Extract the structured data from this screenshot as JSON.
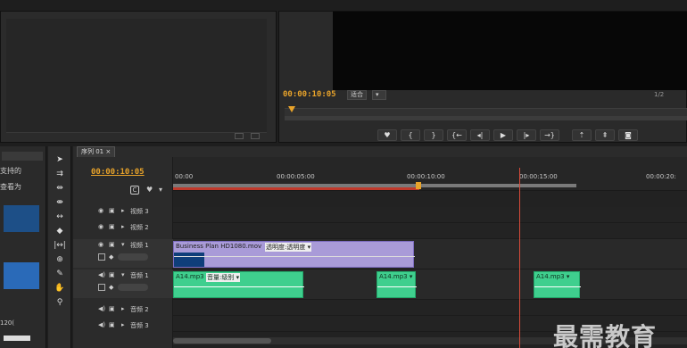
{
  "monitor": {
    "timecode": "00:00:10:05",
    "fit_label": "适合",
    "page": "1/2"
  },
  "sequence": {
    "tab_label": "序列 01 ×",
    "timecode": "00:00:10:05",
    "ruler_labels": [
      "00:00",
      "00:00:05:00",
      "00:00:10:00",
      "00:00:15:00",
      "00:00:20:"
    ],
    "tracks": [
      {
        "name": "视频 3"
      },
      {
        "name": "视频 2"
      },
      {
        "name": "视频 1"
      },
      {
        "name": "音频 1"
      },
      {
        "name": "音频 2"
      },
      {
        "name": "音频 3"
      }
    ],
    "video_clip": {
      "name": "Business Plan HD1080.mov",
      "effect": "透明度:透明度 ▾"
    },
    "audio_clips": [
      {
        "name": "A14.mp3",
        "effect": "音量:级别 ▾"
      },
      {
        "name": "A14.mp3 ▾"
      },
      {
        "name": "A14.mp3 ▾"
      }
    ]
  },
  "left_panel": {
    "labels": [
      "支持的",
      "查看为",
      "120("
    ]
  },
  "watermark": "最需教育"
}
